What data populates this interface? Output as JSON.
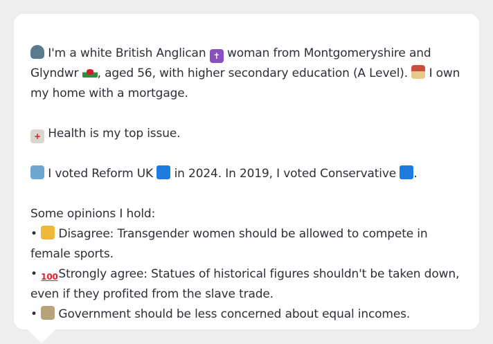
{
  "profile": {
    "intro_1": "I'm a white British Anglican",
    "intro_2": "woman from Montgomeryshire and Glyndwr",
    "intro_3": ", aged 56, with higher secondary education (A Level).",
    "intro_4": "I own my home with a mortgage.",
    "health": "Health is my top issue.",
    "vote_1": "I voted Reform UK",
    "vote_2": "in 2024. In 2019, I voted Conservative",
    "vote_3": ".",
    "opinions_header": "Some opinions I hold:",
    "bullet": "•",
    "opinion_1": "Disagree: Transgender women should be allowed to compete in female sports.",
    "opinion_2": "Strongly agree: Statues of historical figures shouldn't be taken down, even if they profited from the slave trade.",
    "opinion_3": "Government should be less concerned about equal incomes."
  },
  "icons": {
    "person": "person-icon",
    "cross": "latin-cross-icon",
    "flag": "wales-flag-icon",
    "house": "house-icon",
    "hospital": "hospital-icon",
    "ballot": "ballot-box-icon",
    "reform_square": "blue-square-icon",
    "conservative_square": "blue-square-icon",
    "thumbs_down": "thumbs-down-icon",
    "hundred": "hundred-points-icon",
    "judge": "judge-icon"
  },
  "colors": {
    "background": "#eeeeef",
    "bubble": "#ffffff",
    "text": "#2c2f36",
    "party_square": "#1e7be0"
  }
}
